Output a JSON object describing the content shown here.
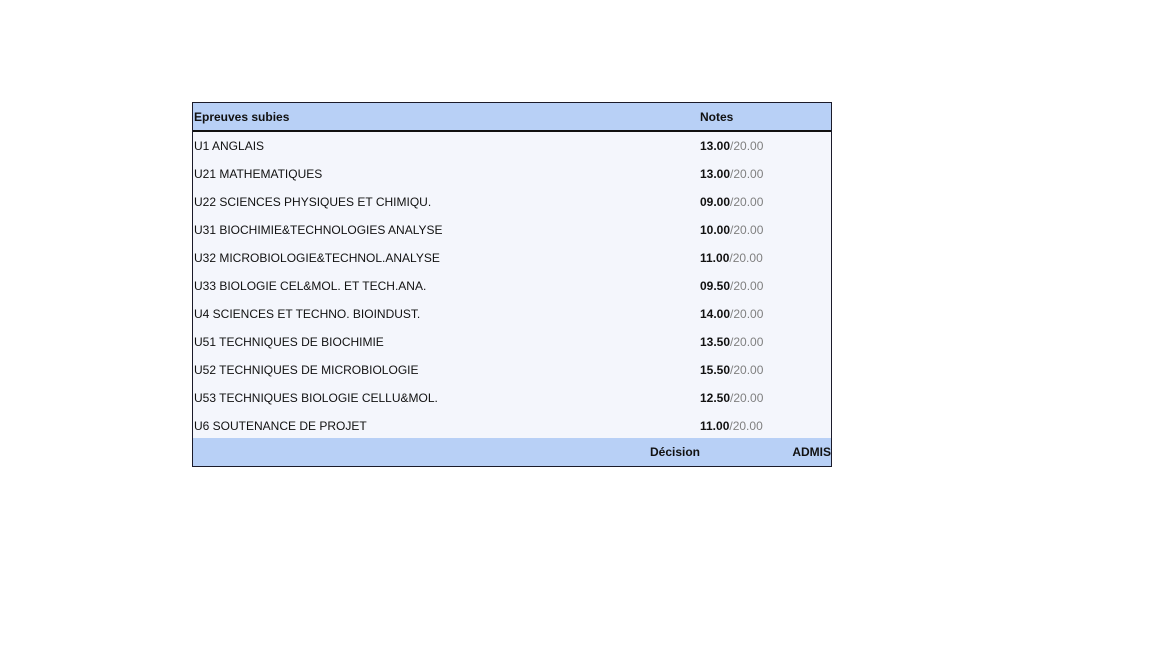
{
  "table": {
    "header": {
      "epreuves": "Epreuves subies",
      "notes": "Notes"
    },
    "rows": [
      {
        "name": "U1 ANGLAIS",
        "note": "13.00",
        "max": "/20.00"
      },
      {
        "name": "U21 MATHEMATIQUES",
        "note": "13.00",
        "max": "/20.00"
      },
      {
        "name": "U22 SCIENCES PHYSIQUES ET CHIMIQU.",
        "note": "09.00",
        "max": "/20.00"
      },
      {
        "name": "U31 BIOCHIMIE&TECHNOLOGIES ANALYSE",
        "note": "10.00",
        "max": "/20.00"
      },
      {
        "name": "U32 MICROBIOLOGIE&TECHNOL.ANALYSE",
        "note": "11.00",
        "max": "/20.00"
      },
      {
        "name": "U33 BIOLOGIE CEL&MOL. ET TECH.ANA.",
        "note": "09.50",
        "max": "/20.00"
      },
      {
        "name": "U4 SCIENCES ET TECHNO. BIOINDUST.",
        "note": "14.00",
        "max": "/20.00"
      },
      {
        "name": "U51 TECHNIQUES DE BIOCHIMIE",
        "note": "13.50",
        "max": "/20.00"
      },
      {
        "name": "U52 TECHNIQUES DE MICROBIOLOGIE",
        "note": "15.50",
        "max": "/20.00"
      },
      {
        "name": "U53 TECHNIQUES BIOLOGIE CELLU&MOL.",
        "note": "12.50",
        "max": "/20.00"
      },
      {
        "name": "U6 SOUTENANCE DE PROJET",
        "note": "11.00",
        "max": "/20.00"
      }
    ],
    "footer": {
      "decision_label": "Décision",
      "decision_value": "ADMIS"
    }
  },
  "colors": {
    "header_bg": "#b8d0f6",
    "body_bg": "#f4f6fc",
    "max_text": "#808080"
  }
}
